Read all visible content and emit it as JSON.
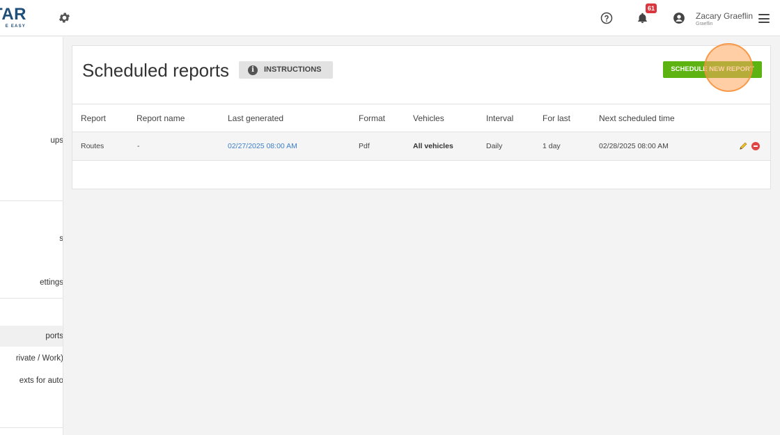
{
  "topbar": {
    "logo_text": "TAR",
    "logo_tagline": "E EASY",
    "notification_count": "61",
    "user_name": "Zacary Graeflin",
    "user_company": "Graeflin"
  },
  "sidebar": {
    "items": [
      {
        "label": "ups"
      },
      {
        "label": "s"
      },
      {
        "label": "ettings"
      },
      {
        "label": "ports"
      },
      {
        "label": "rivate / Work)"
      },
      {
        "label": "exts for auto"
      }
    ]
  },
  "page": {
    "title": "Scheduled reports",
    "instructions_label": "INSTRUCTIONS",
    "schedule_button_label": "SCHEDULE NEW REPORT"
  },
  "table": {
    "columns": [
      "Report",
      "Report name",
      "Last generated",
      "Format",
      "Vehicles",
      "Interval",
      "For last",
      "Next scheduled time"
    ],
    "rows": [
      {
        "report": "Routes",
        "report_name": "-",
        "last_generated": "02/27/2025 08:00 AM",
        "format": "Pdf",
        "vehicles": "All vehicles",
        "interval": "Daily",
        "for_last": "1 day",
        "next_scheduled": "02/28/2025 08:00 AM"
      }
    ]
  },
  "colors": {
    "accent_green": "#5cb312",
    "link_blue": "#3d7fc9",
    "badge_red": "#d9363e",
    "logo_blue": "#1f4e79",
    "highlight_orange": "#f59a4a"
  },
  "icons": [
    "gear-icon",
    "help-icon",
    "bell-icon",
    "user-icon",
    "menu-icon",
    "info-icon",
    "edit-icon",
    "delete-icon"
  ]
}
